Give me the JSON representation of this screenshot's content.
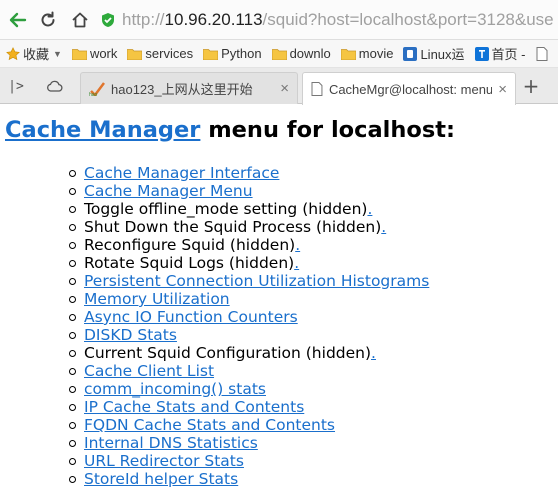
{
  "browser": {
    "url_prefix": "http://",
    "url_host": "10.96.20.113",
    "url_rest": "/squid?host=localhost&port=3128&use",
    "bookmarks": [
      {
        "label": "收藏",
        "icon": "star-icon",
        "has_dropdown": true
      },
      {
        "label": "work",
        "icon": "folder-icon"
      },
      {
        "label": "services",
        "icon": "folder-icon"
      },
      {
        "label": "Python",
        "icon": "folder-icon"
      },
      {
        "label": "downlo",
        "icon": "folder-icon"
      },
      {
        "label": "movie",
        "icon": "folder-icon"
      },
      {
        "label": "Linux运",
        "icon": "linux-site-icon"
      },
      {
        "label": "首页 -",
        "icon": "zhihu-icon"
      }
    ],
    "tabs": [
      {
        "title": "hao123_上网从这里开始",
        "icon": "hao123-icon",
        "active": false
      },
      {
        "title": "CacheMgr@localhost: menu",
        "icon": "page-icon",
        "active": true
      }
    ],
    "close_glyph": "×",
    "new_tab_glyph": "+",
    "tab_history_glyph": "|>"
  },
  "page": {
    "title_link": "Cache Manager",
    "title_rest": " menu for localhost:",
    "menu": [
      {
        "text": "Cache Manager Interface",
        "link": true
      },
      {
        "text": "Cache Manager Menu",
        "link": true
      },
      {
        "text": "Toggle offline_mode setting (hidden)",
        "link": false,
        "dot": "."
      },
      {
        "text": "Shut Down the Squid Process (hidden)",
        "link": false,
        "dot": "."
      },
      {
        "text": "Reconfigure Squid (hidden)",
        "link": false,
        "dot": "."
      },
      {
        "text": "Rotate Squid Logs (hidden)",
        "link": false,
        "dot": "."
      },
      {
        "text": "Persistent Connection Utilization Histograms",
        "link": true
      },
      {
        "text": "Memory Utilization",
        "link": true
      },
      {
        "text": "Async IO Function Counters",
        "link": true
      },
      {
        "text": "DISKD Stats",
        "link": true
      },
      {
        "text": "Current Squid Configuration (hidden)",
        "link": false,
        "dot": "."
      },
      {
        "text": "Cache Client List",
        "link": true
      },
      {
        "text": "comm_incoming() stats",
        "link": true
      },
      {
        "text": "IP Cache Stats and Contents",
        "link": true
      },
      {
        "text": "FQDN Cache Stats and Contents",
        "link": true
      },
      {
        "text": "Internal DNS Statistics",
        "link": true
      },
      {
        "text": "URL Redirector Stats",
        "link": true
      },
      {
        "text": "StoreId helper Stats",
        "link": true
      }
    ]
  },
  "colors": {
    "link": "#1a6fcc",
    "shield": "#2eaa3c"
  }
}
